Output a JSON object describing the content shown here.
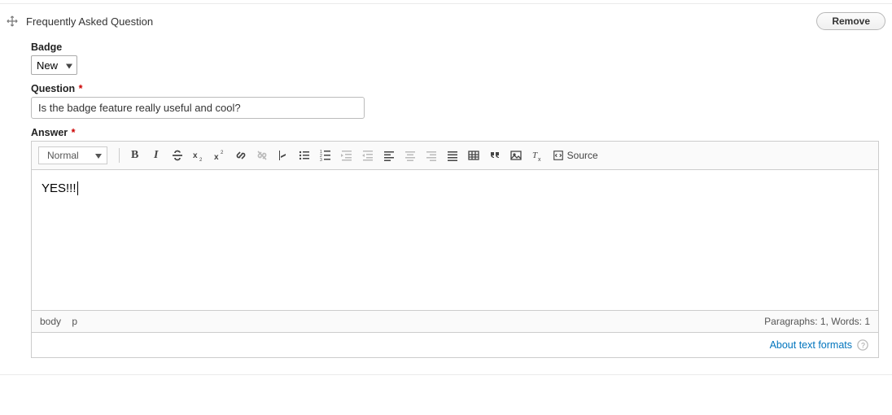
{
  "section": {
    "title": "Frequently Asked Question",
    "remove_label": "Remove"
  },
  "badge": {
    "label": "Badge",
    "selected": "New"
  },
  "question": {
    "label": "Question",
    "required_marker": "*",
    "value": "Is the badge feature really useful and cool?"
  },
  "answer": {
    "label": "Answer",
    "required_marker": "*",
    "format_combo": "Normal",
    "source_label": "Source",
    "content": "YES!!!",
    "path": {
      "p1": "body",
      "p2": "p"
    },
    "status": "Paragraphs: 1, Words: 1",
    "formats_link": "About text formats"
  }
}
